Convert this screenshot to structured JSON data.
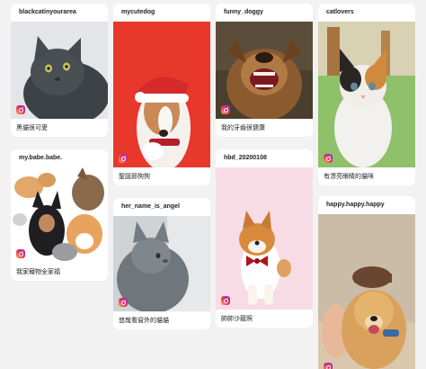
{
  "posts": [
    {
      "username": "blackcatinyourarea",
      "caption": "黑貓很可愛",
      "photo": "gray-cat-photo"
    },
    {
      "username": "mycutedog",
      "caption": "聖誕節狗狗",
      "photo": "santa-hat-dog-photo"
    },
    {
      "username": "funny_doggy",
      "caption": "我的牙齒很健康",
      "photo": "barking-dog-photo"
    },
    {
      "username": "catlovers",
      "caption": "有漂亮眼睛的貓咪",
      "photo": "calico-cat-photo"
    },
    {
      "username": "my.babe.babe.",
      "caption": "我家寵物全家福",
      "photo": "pets-family-photo"
    },
    {
      "username": "hbd_20200108",
      "caption": "帥帥沙龍照",
      "photo": "shiba-inu-photo"
    },
    {
      "username": "her_name_is_angel",
      "caption": "悠哉看窗外的貓貓",
      "photo": "cat-window-photo"
    },
    {
      "username": "happy.happy.happy",
      "caption": "",
      "photo": "golden-retriever-photo"
    }
  ],
  "icon": "instagram-icon",
  "colors": {
    "background": "#f2f2f2",
    "card": "#ffffff",
    "santa_red": "#e8382c",
    "pink": "#f7dce6"
  }
}
